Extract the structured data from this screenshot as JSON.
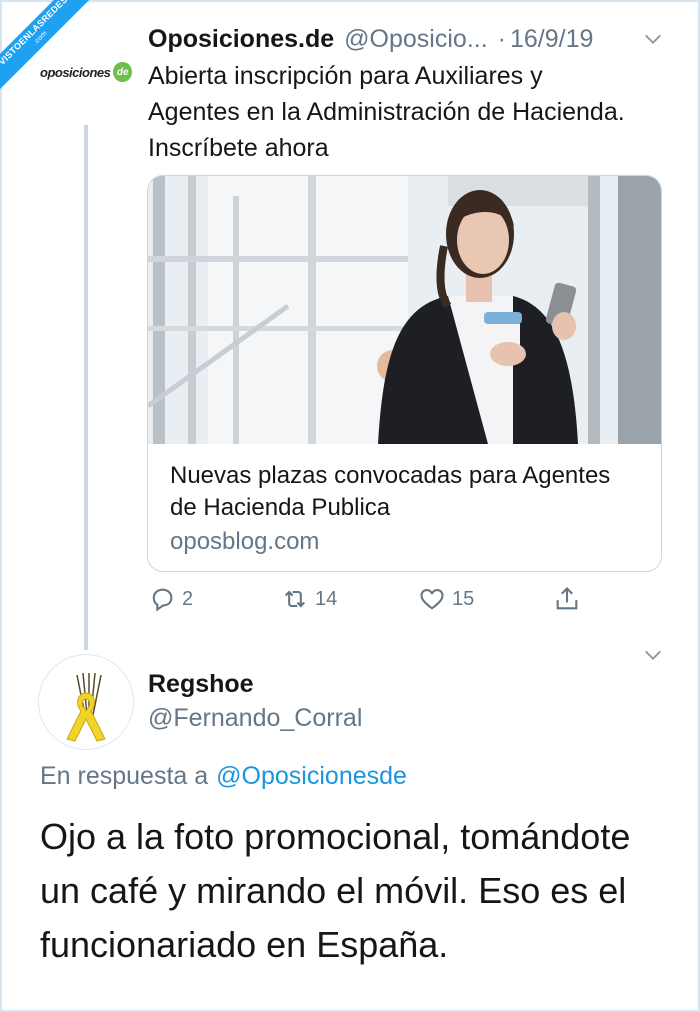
{
  "watermark": {
    "text": "VISTOENLASREDES",
    "sub": ".com"
  },
  "tweet1": {
    "avatar_logo": "oposiciones",
    "avatar_badge": "de",
    "name": "Oposiciones.de",
    "handle": "@Oposicio...",
    "separator": "·",
    "date": "16/9/19",
    "text": "Abierta inscripción para Auxiliares y Agentes en la Administración de Hacienda. Inscríbete ahora",
    "card": {
      "title": "Nuevas plazas convocadas para Agentes de Hacienda Publica",
      "domain": "oposblog.com"
    },
    "actions": {
      "reply_count": "2",
      "retweet_count": "14",
      "like_count": "15"
    }
  },
  "tweet2": {
    "name": "Regshoe",
    "handle": "@Fernando_Corral",
    "reply_prefix": "En respuesta a",
    "reply_mention": "@Oposicionesde",
    "text": "Ojo a la foto promocional, tomándote un café y mirando el móvil. Eso es el funcionariado en España."
  },
  "colors": {
    "link_blue": "#1b95e0",
    "secondary_gray": "#657786",
    "text_dark": "#14171a",
    "ribbon_blue": "#1da1f2"
  }
}
